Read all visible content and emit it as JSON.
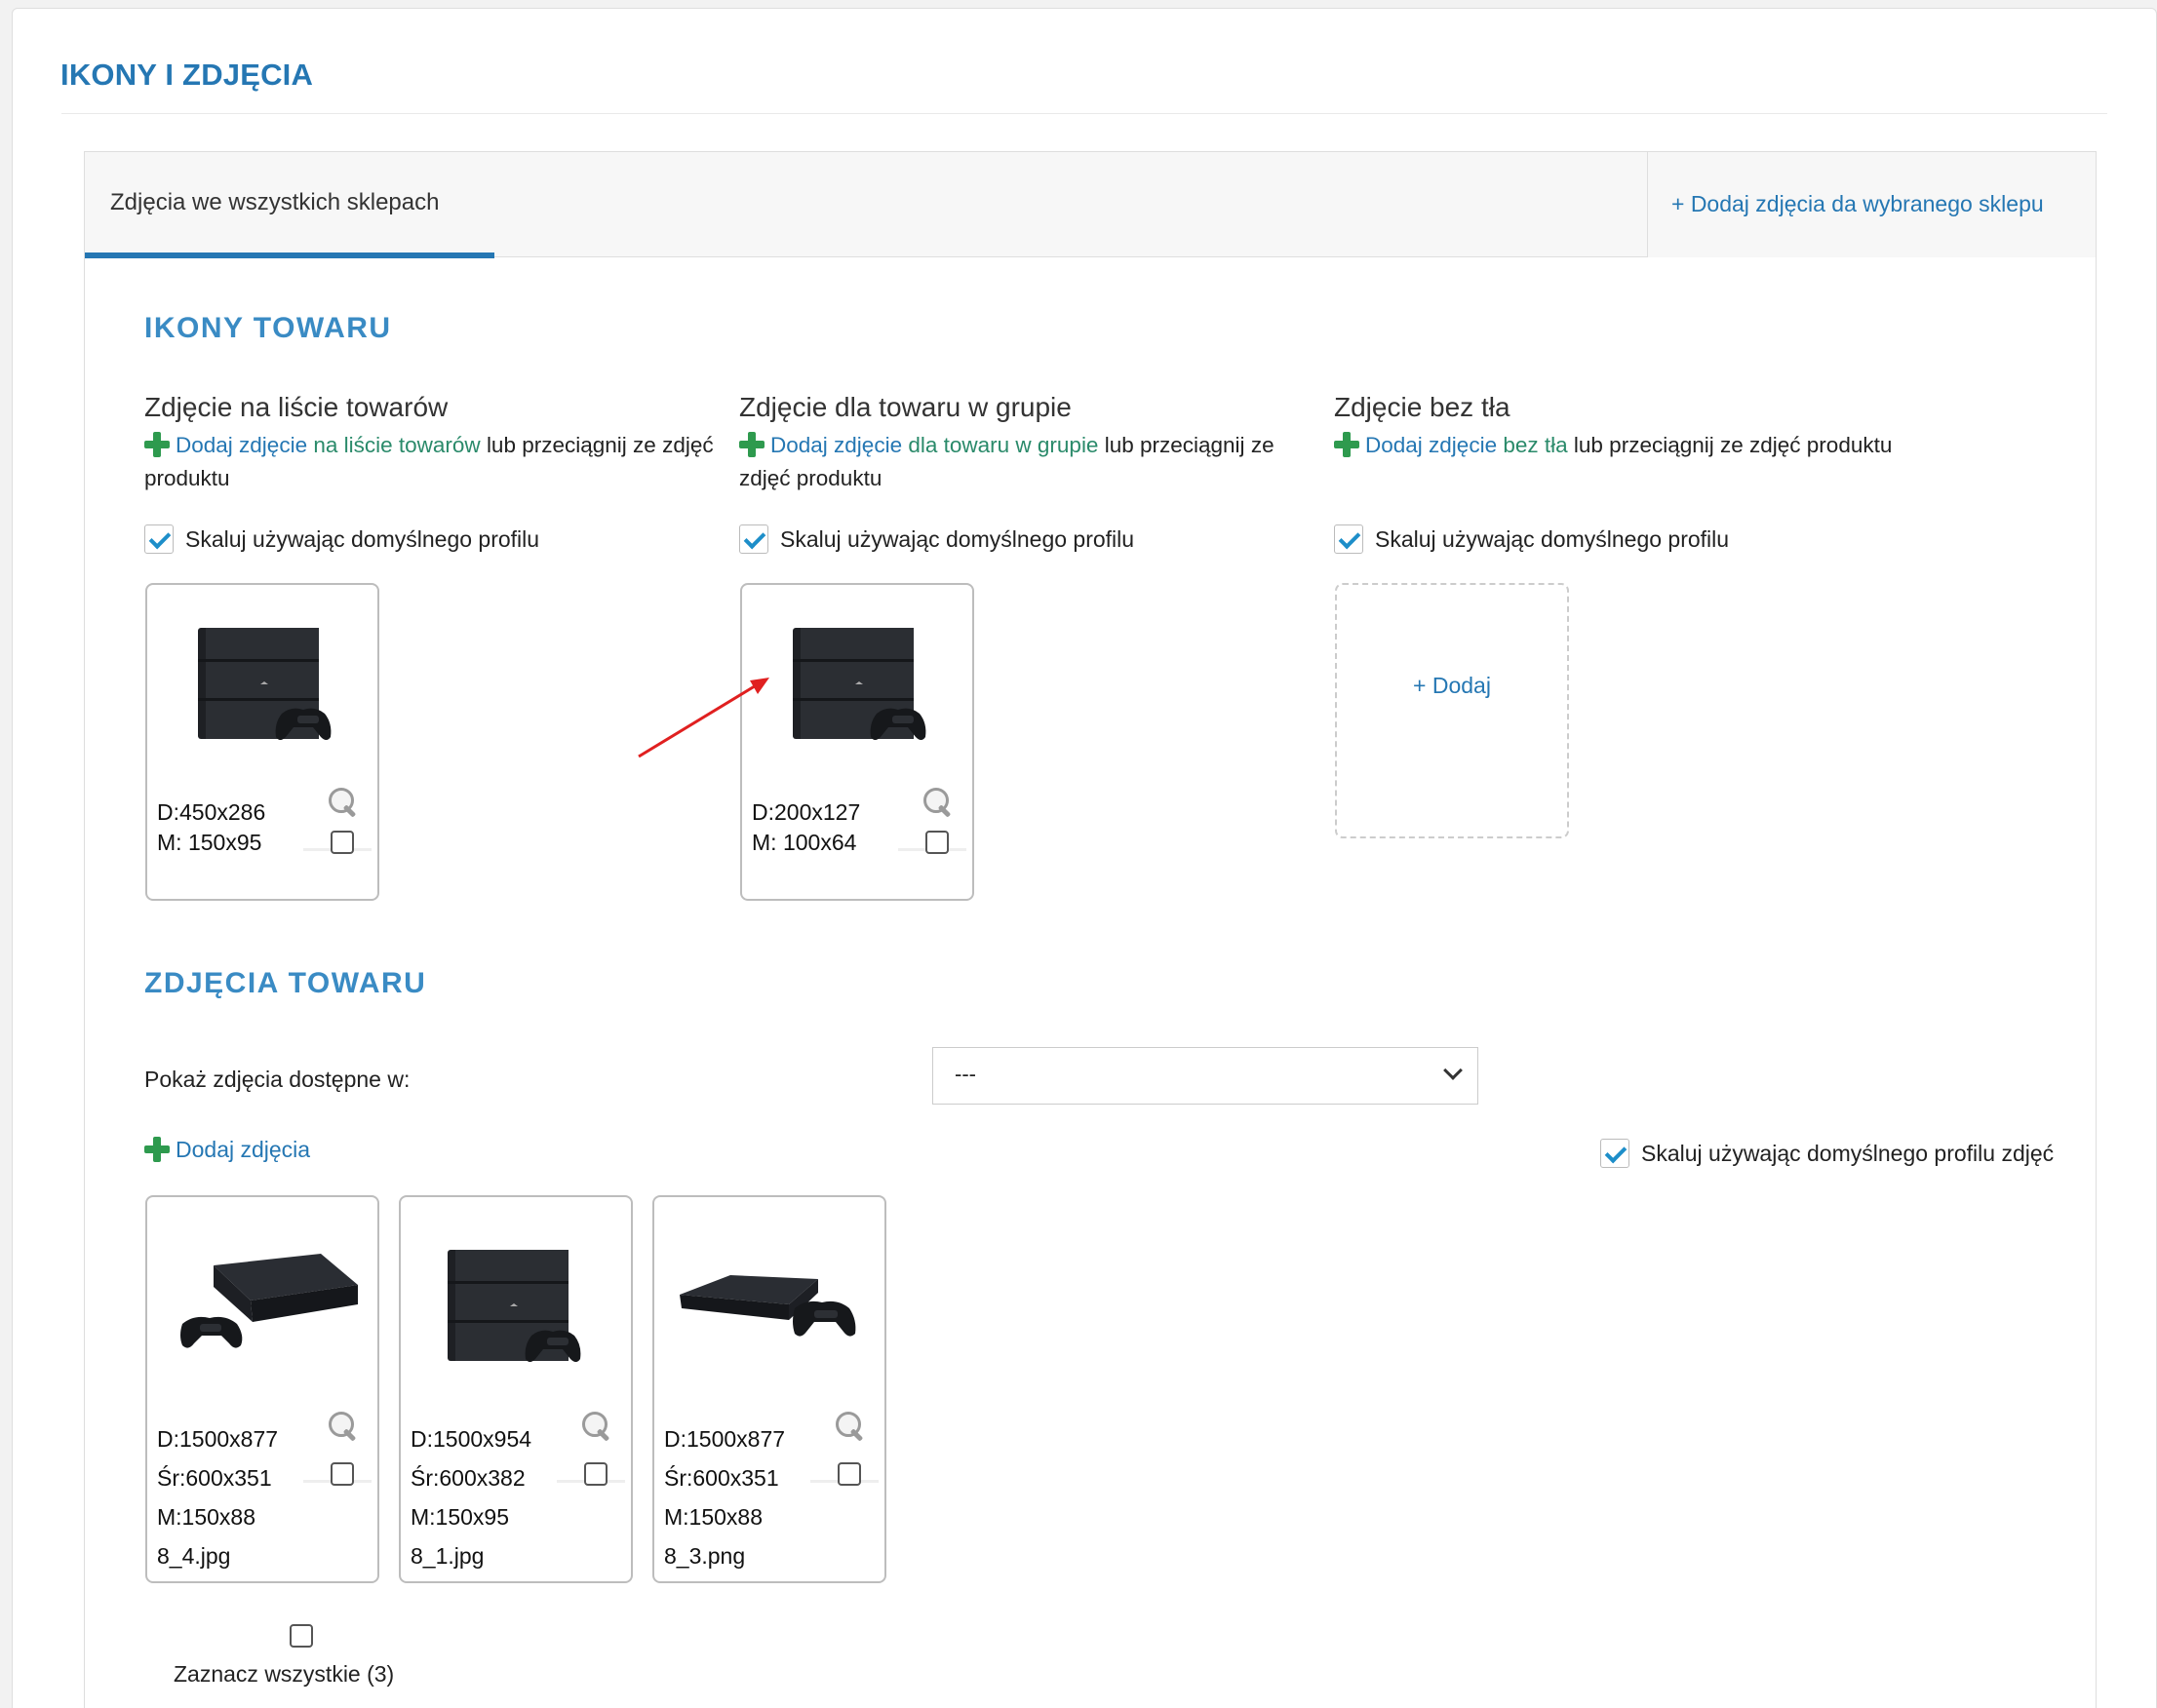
{
  "page": {
    "title": "IKONY I ZDJĘCIA"
  },
  "tabs": {
    "all_shops": "Zdjęcia we wszystkich sklepach",
    "add_for_shop": "+ Dodaj zdjęcia da wybranego sklepu"
  },
  "icons_section": {
    "title": "IKONY TOWARU",
    "columns": [
      {
        "title": "Zdjęcie na liście towarów",
        "add_link": "Dodaj zdjęcie",
        "target_link": "na liście towarów",
        "suffix": "lub przeciągnij ze",
        "suffix2": "zdjęć produktu",
        "scale_label": "Skaluj używając domyślnego profilu",
        "scale_checked": true,
        "tile": {
          "line1": "D:450x286",
          "line2": "M: 150x95"
        }
      },
      {
        "title": "Zdjęcie dla towaru w grupie",
        "add_link": "Dodaj zdjęcie",
        "target_link": "dla towaru w grupie",
        "suffix": "lub przeciągnij",
        "suffix2": "ze zdjęć produktu",
        "scale_label": "Skaluj używając domyślnego profilu",
        "scale_checked": true,
        "tile": {
          "line1": "D:200x127",
          "line2": "M: 100x64"
        }
      },
      {
        "title": "Zdjęcie bez tła",
        "add_link": "Dodaj zdjęcie",
        "target_link": "bez tła",
        "suffix": "lub przeciągnij ze zdjęć",
        "suffix2": "produktu",
        "scale_label": "Skaluj używając domyślnego profilu",
        "scale_checked": true,
        "empty_tile_label": "+ Dodaj"
      }
    ]
  },
  "photos_section": {
    "title": "ZDJĘCIA TOWARU",
    "filter_label": "Pokaż zdjęcia dostępne w:",
    "filter_value": "---",
    "add_photos": "Dodaj zdjęcia",
    "scale_label": "Skaluj używając domyślnego profilu zdjęć",
    "scale_checked": true,
    "photos": [
      {
        "d": "D:1500x877",
        "sr": "Śr:600x351",
        "m": "M:150x88",
        "file": "8_4.jpg"
      },
      {
        "d": "D:1500x954",
        "sr": "Śr:600x382",
        "m": "M:150x95",
        "file": "8_1.jpg"
      },
      {
        "d": "D:1500x877",
        "sr": "Śr:600x351",
        "m": "M:150x88",
        "file": "8_3.png"
      }
    ],
    "select_all": "Zaznacz wszystkie (3)"
  },
  "colors": {
    "accent": "#2577b3",
    "section": "#3a8bc4",
    "plus": "#2e9a4e",
    "arrow": "#e02020"
  }
}
